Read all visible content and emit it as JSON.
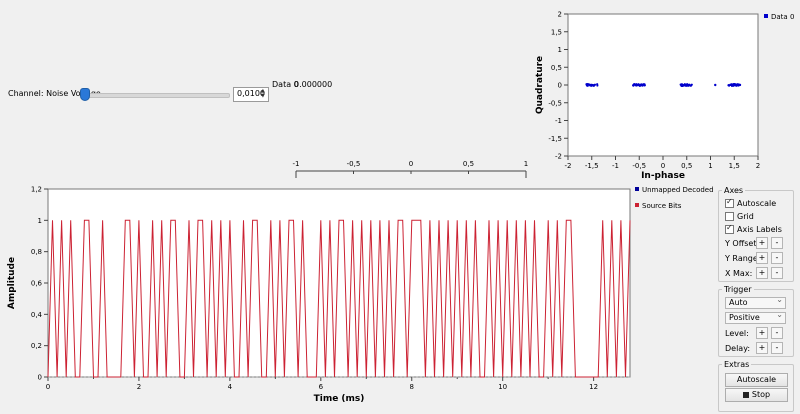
{
  "noise": {
    "label": "Channel: Noise Voltage",
    "value": "0,0100",
    "level": 0.0
  },
  "number_sink": {
    "label": "Data 0",
    "value": "0.000000",
    "scale": [
      "-1",
      "-0,5",
      "0",
      "0,5",
      "1"
    ]
  },
  "controls": {
    "axes_title": "Axes",
    "autoscale": "Autoscale",
    "grid": "Grid",
    "axis_labels": "Axis Labels",
    "y_offset": "Y Offset:",
    "y_range": "Y Range:",
    "x_max": "X Max:",
    "trigger_title": "Trigger",
    "trigger_mode": "Auto",
    "trigger_slope": "Positive",
    "level": "Level:",
    "delay": "Delay:",
    "extras_title": "Extras",
    "autoscale_btn": "Autoscale",
    "stop_btn": "Stop",
    "plus": "+",
    "minus": "-",
    "autoscale_checked": true,
    "grid_checked": false,
    "axis_labels_checked": true
  },
  "constellation_chart": {
    "type": "scatter",
    "xlabel": "In-phase",
    "ylabel": "Quadrature",
    "xlim": [
      -2,
      2
    ],
    "ylim": [
      -2,
      2
    ],
    "xticks": [
      "-2",
      "-1,5",
      "-1",
      "-0,5",
      "0",
      "0,5",
      "1",
      "1,5",
      "2"
    ],
    "yticks": [
      "2",
      "1,5",
      "1",
      "0,5",
      "0",
      "-0,5",
      "-1",
      "-1,5",
      "-2"
    ],
    "legend": [
      "Data 0"
    ],
    "clusters": [
      -1.5,
      -0.5,
      0.5,
      1.5
    ],
    "outlier": 1.1,
    "color": "#0000cc"
  },
  "time_chart": {
    "type": "line",
    "xlabel": "Time (ms)",
    "ylabel": "Amplitude",
    "xlim": [
      0,
      12.8
    ],
    "ylim": [
      0,
      1.2
    ],
    "xticks": [
      "0",
      "2",
      "4",
      "6",
      "8",
      "10",
      "12"
    ],
    "yticks": [
      "1,2",
      "1",
      "0,8",
      "0,6",
      "0,4",
      "0,2",
      "0"
    ],
    "legend": [
      "Unmapped Decoded Bits",
      "Source Bits"
    ],
    "series_colors": [
      "#000099",
      "#cc2233"
    ],
    "bits": [
      0,
      1,
      0,
      1,
      0,
      1,
      0,
      0,
      1,
      1,
      0,
      0,
      1,
      0,
      0,
      0,
      0,
      1,
      1,
      0,
      1,
      0,
      0,
      1,
      0,
      1,
      0,
      1,
      1,
      0,
      0,
      1,
      0,
      1,
      1,
      0,
      1,
      0,
      1,
      0,
      1,
      0,
      0,
      1,
      0,
      1,
      1,
      0,
      0,
      1,
      0,
      1,
      0,
      1,
      1,
      0,
      1,
      0,
      0,
      0,
      1,
      0,
      1,
      0,
      1,
      1,
      0,
      1,
      0,
      1,
      0,
      1,
      0,
      1,
      0,
      1,
      0,
      1,
      1,
      0,
      1,
      1,
      1,
      0,
      1,
      0,
      1,
      0,
      1,
      0,
      1,
      0,
      1,
      0,
      1,
      0,
      0,
      1,
      0,
      1,
      0,
      1,
      0,
      1,
      0,
      1,
      0,
      1,
      0,
      0,
      1,
      0,
      1,
      0,
      1,
      1,
      0,
      0,
      0,
      0,
      0,
      0,
      1,
      0,
      1,
      0,
      1,
      0,
      1
    ]
  }
}
